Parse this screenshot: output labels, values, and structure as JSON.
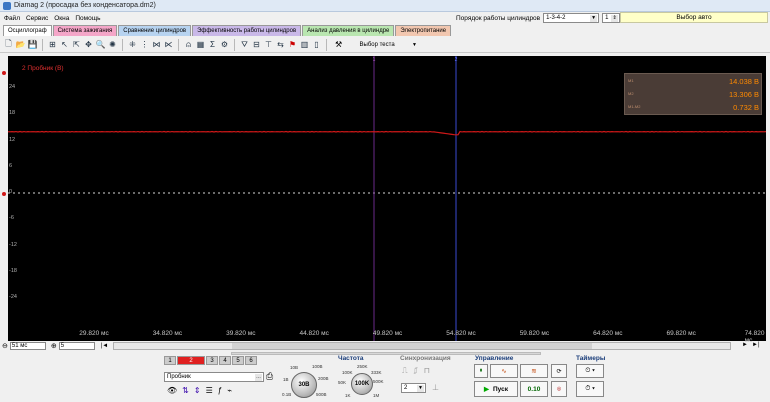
{
  "window": {
    "title": "Diamag 2 (просадка без конденсатора.dm2)"
  },
  "menu": [
    "Файл",
    "Сервис",
    "Окна",
    "Помощь"
  ],
  "cylinder_order": {
    "label": "Порядок работы цилиндров",
    "value": "1-3-4-2",
    "index_value": "1"
  },
  "auto_select": "Выбор авто",
  "tabs": [
    {
      "label": "Осциллограф",
      "color": "#ffffff"
    },
    {
      "label": "Система зажигания",
      "color": "#f4a6c8"
    },
    {
      "label": "Сравнение цилиндров",
      "color": "#b7d3f0"
    },
    {
      "label": "Эффективность работы цилиндров",
      "color": "#c9b8e8"
    },
    {
      "label": "Анализ давления в цилиндре",
      "color": "#b9e6b0"
    },
    {
      "label": "Электропитание",
      "color": "#f2c7b0"
    }
  ],
  "toolbar": {
    "test_select": "Выбор теста"
  },
  "scope": {
    "channel_label": "2 Пробник (В)",
    "trace_color": "#d01818",
    "y_labels": [
      "24",
      "18",
      "12",
      "6",
      "0",
      "-6",
      "-12",
      "-18",
      "-24"
    ],
    "x_labels": [
      "29.820 мс",
      "34.820 мс",
      "39.820 мс",
      "44.820 мс",
      "49.820 мс",
      "54.820 мс",
      "59.820 мс",
      "64.820 мс",
      "69.820 мс",
      "74.820 мс"
    ],
    "cursor_1_label": "1",
    "cursor_2_label": "2",
    "readout": [
      {
        "key": "M1",
        "value": "14.038 В"
      },
      {
        "key": "M2",
        "value": "13.306 В"
      },
      {
        "key": "M1-M2",
        "value": "0.732 В"
      }
    ],
    "trace": {
      "baseline_v": 14.0,
      "dip_v": 13.3
    }
  },
  "scroll": {
    "timebase": "51 мс",
    "zoom": "5"
  },
  "bottom": {
    "channels": [
      "1",
      "2",
      "3",
      "4",
      "5",
      "6"
    ],
    "active_channel": "2",
    "probe": "Пробник",
    "voltage": {
      "knob": "30В",
      "ticks": [
        "10В",
        "100В",
        "1В",
        "200В",
        "0.1В",
        "500В"
      ]
    },
    "frequency": {
      "title": "Частота",
      "knob": "100K",
      "ticks": [
        "250K",
        "100K",
        "333K",
        "50K",
        "500K",
        "1K",
        "1M"
      ]
    },
    "sync": {
      "title": "Синхронизация",
      "value": "2"
    },
    "control": {
      "title": "Управление",
      "start": "Пуск",
      "value": "0.10"
    },
    "timers": {
      "title": "Таймеры"
    }
  }
}
